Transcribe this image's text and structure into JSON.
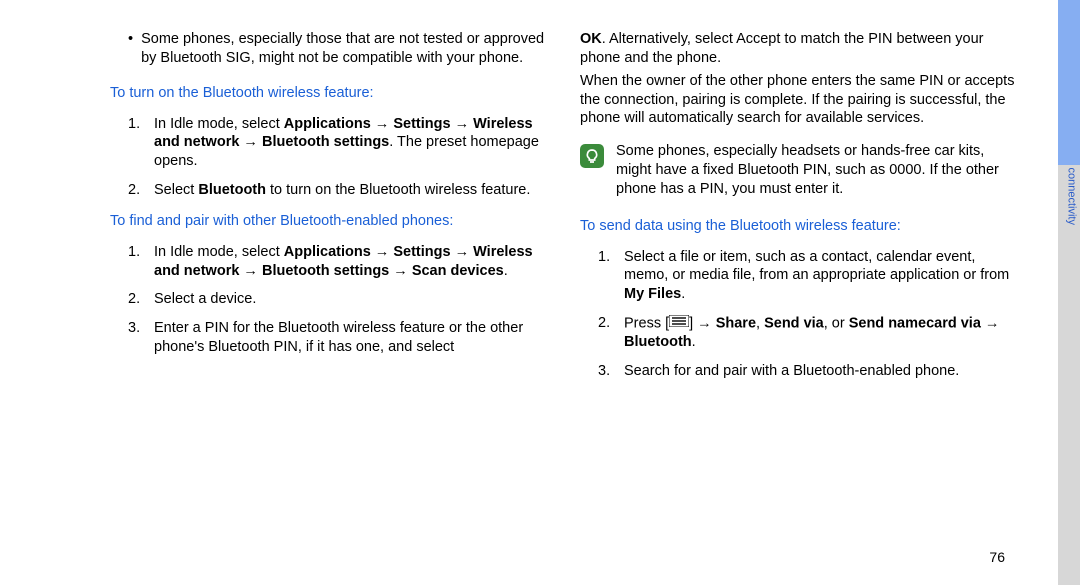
{
  "left": {
    "bullet1": "Some phones, especially those that are not tested or approved by Bluetooth SIG, might not be compatible with your phone.",
    "heading1": "To turn on the Bluetooth wireless feature:",
    "step1a_pre": "In Idle mode, select ",
    "step1a_b1": "Applications",
    "arrow": " → ",
    "step1a_b2": "Settings",
    "step1a_b3": "Wireless and network",
    "step1a_b4": "Bluetooth settings",
    "step1a_post": ". The preset homepage opens.",
    "step1b_pre": "Select ",
    "step1b_b": "Bluetooth",
    "step1b_post": " to turn on the Bluetooth wireless feature.",
    "heading2": "To find and pair with other Bluetooth-enabled phones:",
    "step2a_pre": "In Idle mode, select ",
    "step2a_b5": "Scan devices",
    "step2a_post": ".",
    "step2b": "Select a device.",
    "step2c": "Enter a PIN for the Bluetooth wireless feature or the other phone's Bluetooth PIN, if it has one, and select "
  },
  "right": {
    "cont1_b": "OK",
    "cont1": ". Alternatively, select Accept to match the PIN between your phone and the phone.",
    "cont2": "When the owner of the other phone enters the same PIN or accepts the connection, pairing is complete. If the pairing is successful, the phone will automatically search for available services.",
    "note": "Some phones, especially headsets or hands-free car kits, might have a fixed Bluetooth PIN, such as 0000. If the other phone has a PIN, you must enter it.",
    "heading3": "To send data using the Bluetooth wireless feature:",
    "step3a_pre": "Select a file or item, such as a contact, calendar event, memo, or media file, from an appropriate application or from ",
    "step3a_b": "My Files",
    "step3a_post": ".",
    "step3b_pre": "Press [",
    "step3b_icon": "menu-icon",
    "step3b_mid": "] → ",
    "step3b_b1": "Share",
    "step3b_sep": ", ",
    "step3b_b2": "Send via",
    "step3b_sep2": ", or ",
    "step3b_b3": "Send namecard via",
    "step3b_b4": "Bluetooth",
    "step3b_post": ".",
    "step3c": "Search for and pair with a Bluetooth-enabled phone."
  },
  "side_label": "connectivity",
  "page_number": "76"
}
